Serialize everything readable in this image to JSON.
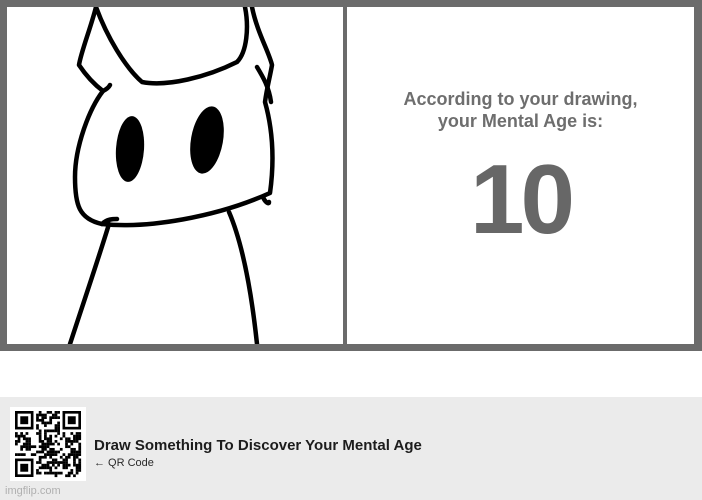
{
  "meme": {
    "result_heading_line1": "According to your drawing,",
    "result_heading_line2": "your Mental Age is:",
    "age_value": "10"
  },
  "footer": {
    "title": "Draw Something To Discover Your Mental Age",
    "subtitle": "← QR Code",
    "watermark": "imgflip.com"
  },
  "colors": {
    "frame": "#6b6b6b",
    "panel": "#ffffff",
    "footer_bg": "#ebebeb",
    "result_text": "#6e6e6e"
  },
  "icons": {
    "qr": "qr-code-icon",
    "drawing": "cat-doodle-drawing"
  }
}
